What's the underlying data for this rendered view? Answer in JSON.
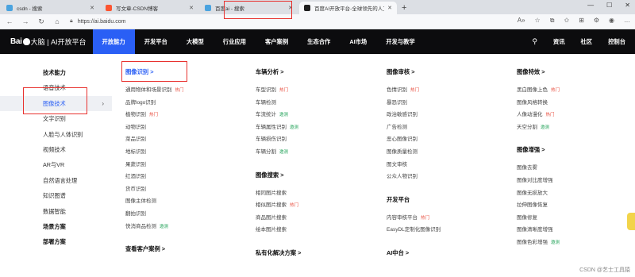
{
  "browser": {
    "tabs": [
      {
        "label": "csdn - 搜索",
        "icon": "bing-icon",
        "color": "#4aa3df",
        "active": false
      },
      {
        "label": "写文章-CSDN博客",
        "icon": "csdn-icon",
        "color": "#fc5531",
        "active": false
      },
      {
        "label": "百度ai - 搜索",
        "icon": "bing-icon",
        "color": "#4aa3df",
        "active": false
      },
      {
        "label": "百度AI开放平台-全球领先的人工",
        "icon": "baidu-ai-icon",
        "color": "#1f1f1f",
        "active": true
      }
    ],
    "url": "https://ai.baidu.com"
  },
  "header": {
    "logo_baidu": "Bai",
    "logo_text": "大脑 | AI开放平台",
    "nav": [
      {
        "label": "开放能力",
        "active": true
      },
      {
        "label": "开发平台"
      },
      {
        "label": "大模型"
      },
      {
        "label": "行业应用"
      },
      {
        "label": "客户案例"
      },
      {
        "label": "生态合作"
      },
      {
        "label": "AI市场"
      },
      {
        "label": "开发与教学"
      }
    ],
    "right": [
      "资讯",
      "社区",
      "控制台"
    ]
  },
  "left_categories": [
    {
      "label": "技术能力",
      "bold": true
    },
    {
      "label": "语音技术"
    },
    {
      "label": "图像技术",
      "active": true
    },
    {
      "label": "文字识别"
    },
    {
      "label": "人脸与人体识别"
    },
    {
      "label": "视频技术"
    },
    {
      "label": "AR与VR"
    },
    {
      "label": "自然语言处理"
    },
    {
      "label": "知识图谱"
    },
    {
      "label": "数据智能"
    },
    {
      "label": "场景方案",
      "bold": true
    },
    {
      "label": "部署方案",
      "bold": true
    }
  ],
  "columns": [
    {
      "groups": [
        {
          "head": "图像识别 >",
          "blue": true,
          "links": [
            {
              "label": "通用物体和场景识别",
              "tag": "热门",
              "tagtype": "hot"
            },
            {
              "label": "品牌logo识别"
            },
            {
              "label": "植物识别",
              "tag": "热门",
              "tagtype": "hot"
            },
            {
              "label": "动物识别"
            },
            {
              "label": "菜品识别"
            },
            {
              "label": "地标识别"
            },
            {
              "label": "果蔬识别"
            },
            {
              "label": "红酒识别"
            },
            {
              "label": "货币识别"
            },
            {
              "label": "图像主体检测"
            },
            {
              "label": "翻拍识别"
            },
            {
              "label": "快消商品检测",
              "tag": "邀测",
              "tagtype": "new"
            }
          ]
        },
        {
          "head": "查看客户案例 >",
          "links": []
        }
      ]
    },
    {
      "groups": [
        {
          "head": "车辆分析 >",
          "links": [
            {
              "label": "车型识别",
              "tag": "热门",
              "tagtype": "hot"
            },
            {
              "label": "车辆检测"
            },
            {
              "label": "车流统计",
              "tag": "邀测",
              "tagtype": "new"
            },
            {
              "label": "车辆属性识别",
              "tag": "邀测",
              "tagtype": "new"
            },
            {
              "label": "车辆损伤识别"
            },
            {
              "label": "车辆分割",
              "tag": "邀测",
              "tagtype": "new"
            }
          ]
        },
        {
          "head": "图像搜索 >",
          "links": [
            {
              "label": "相同图片搜索"
            },
            {
              "label": "相似图片搜索",
              "tag": "热门",
              "tagtype": "hot"
            },
            {
              "label": "商品图片搜索"
            },
            {
              "label": "绘本图片搜索"
            }
          ]
        },
        {
          "head": "私有化解决方案 >",
          "links": []
        }
      ]
    },
    {
      "groups": [
        {
          "head": "图像审核 >",
          "links": [
            {
              "label": "色情识别",
              "tag": "热门",
              "tagtype": "hot"
            },
            {
              "label": "暴恐识别"
            },
            {
              "label": "政治敏感识别"
            },
            {
              "label": "广告检测"
            },
            {
              "label": "恶心图像识别"
            },
            {
              "label": "图像质量检测"
            },
            {
              "label": "图文审核"
            },
            {
              "label": "公众人物识别"
            }
          ]
        },
        {
          "head": "开发平台",
          "links": [
            {
              "label": "内容审核平台",
              "tag": "热门",
              "tagtype": "hot"
            },
            {
              "label": "EasyDL定制化图像识别"
            }
          ]
        },
        {
          "head": "AI中台 >",
          "links": []
        }
      ]
    },
    {
      "groups": [
        {
          "head": "图像特效 >",
          "links": [
            {
              "label": "黑白图像上色",
              "tag": "热门",
              "tagtype": "hot"
            },
            {
              "label": "图像风格转换"
            },
            {
              "label": "人像动漫化",
              "tag": "热门",
              "tagtype": "hot"
            },
            {
              "label": "天空分割",
              "tag": "邀测",
              "tagtype": "new"
            }
          ]
        },
        {
          "head": "图像增强 >",
          "links": [
            {
              "label": "图像去雾"
            },
            {
              "label": "图像对比度增强"
            },
            {
              "label": "图像无损放大"
            },
            {
              "label": "拉伸图像恢复"
            },
            {
              "label": "图像修复"
            },
            {
              "label": "图像清晰度增强"
            },
            {
              "label": "图像色彩增强",
              "tag": "邀测",
              "tagtype": "new"
            }
          ]
        }
      ]
    }
  ],
  "watermark": "CSDN @艺士工具猿"
}
